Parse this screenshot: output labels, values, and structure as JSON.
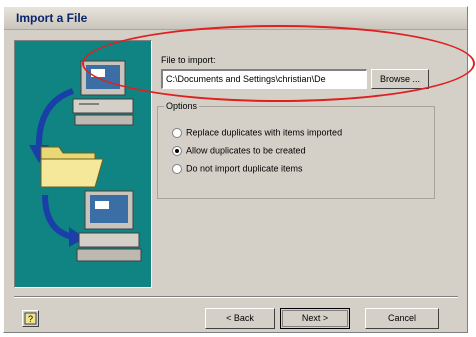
{
  "window": {
    "title": "Import a File"
  },
  "file_import": {
    "label": "File to import:",
    "value": "C:\\Documents and Settings\\christian\\De",
    "browse_label": "Browse ..."
  },
  "options": {
    "legend": "Options",
    "items": [
      {
        "label": "Replace duplicates with items imported",
        "checked": false
      },
      {
        "label": "Allow duplicates to be created",
        "checked": true
      },
      {
        "label": "Do not import duplicate items",
        "checked": false
      }
    ]
  },
  "footer": {
    "back_label": "< Back",
    "next_label": "Next >",
    "cancel_label": "Cancel"
  },
  "icons": [
    "computer-icon",
    "arrow-down-icon",
    "folder-icon",
    "help-icon"
  ],
  "colors": {
    "illustration_bg": "#0f8482",
    "highlight": "#e02020",
    "title_text": "#0a246a"
  }
}
